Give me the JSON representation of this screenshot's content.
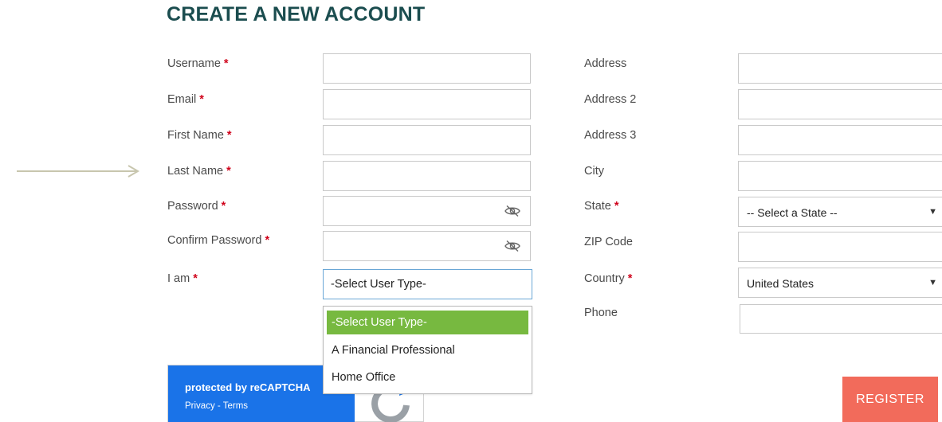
{
  "page": {
    "title": "CREATE A NEW ACCOUNT",
    "required_marker": "*"
  },
  "left_fields": {
    "username": {
      "label": "Username",
      "value": ""
    },
    "email": {
      "label": "Email",
      "value": ""
    },
    "first_name": {
      "label": "First Name",
      "value": ""
    },
    "last_name": {
      "label": "Last Name",
      "value": ""
    },
    "password": {
      "label": "Password",
      "value": ""
    },
    "confirm_password": {
      "label": "Confirm Password",
      "value": ""
    },
    "i_am": {
      "label": "I am",
      "selected": "-Select User Type-",
      "options": [
        "-Select User Type-",
        "A Financial Professional",
        "Home Office"
      ]
    }
  },
  "right_fields": {
    "address": {
      "label": "Address",
      "value": ""
    },
    "address2": {
      "label": "Address 2",
      "value": ""
    },
    "address3": {
      "label": "Address 3",
      "value": ""
    },
    "city": {
      "label": "City",
      "value": ""
    },
    "state": {
      "label": "State",
      "selected": "-- Select a State --"
    },
    "zip": {
      "label": "ZIP Code",
      "value": ""
    },
    "country": {
      "label": "Country",
      "selected": "United States"
    },
    "phone": {
      "label": "Phone",
      "value": ""
    }
  },
  "recaptcha": {
    "protected_text": "protected by reCAPTCHA",
    "privacy": "Privacy",
    "separator": " - ",
    "terms": "Terms"
  },
  "actions": {
    "register_label": "REGISTER"
  },
  "colors": {
    "title": "#1b4d4f",
    "required": "#d0021b",
    "selected_option": "#77b940",
    "recaptcha_blue": "#1a73e8",
    "register": "#f26b5b",
    "arrow": "#c8c6ae"
  },
  "icons": {
    "password_toggle": "eye-slash-icon",
    "annotation": "arrow-right-icon",
    "recaptcha_logo": "recaptcha-logo-icon",
    "select_caret": "caret-down-icon"
  }
}
